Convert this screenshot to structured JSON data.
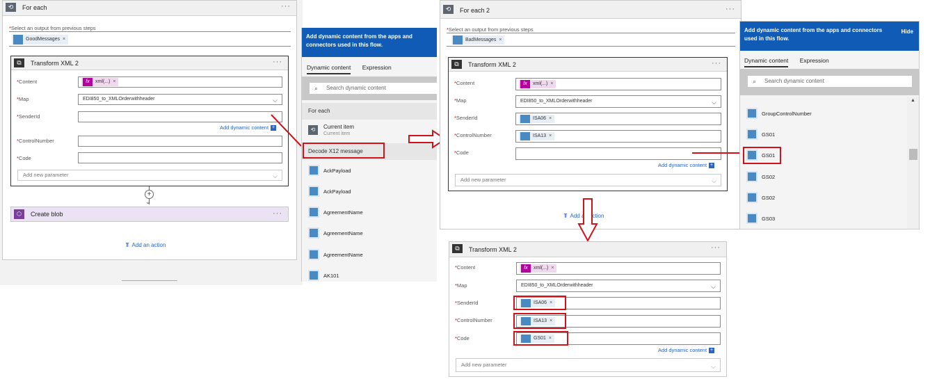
{
  "foreach1": {
    "title": "For each",
    "select_label": "Select an output from previous steps",
    "token": "GoodMessages",
    "transform": {
      "title": "Transform XML 2",
      "content_label": "Content",
      "content_token": "xml(...)",
      "map_label": "Map",
      "map_value": "EDI850_to_XMLOrderwithheader",
      "senderid_label": "SenderId",
      "add_dynamic": "Add dynamic content",
      "controlnumber_label": "ControlNumber",
      "code_label": "Code",
      "add_param": "Add new parameter"
    },
    "create_blob": "Create blob",
    "add_action": "Add an action"
  },
  "panel1": {
    "header": "Add dynamic content from the apps and connectors used in this flow.",
    "tab_dynamic": "Dynamic content",
    "tab_expression": "Expression",
    "search_placeholder": "Search dynamic content",
    "section_for_each": "For each",
    "current_item": "Current item",
    "current_item_sub": "Current item",
    "section_decode": "Decode X12 message",
    "items": [
      "AckPayload",
      "AckPayload",
      "AgreementName",
      "AgreementName",
      "AgreementName",
      "AK101"
    ]
  },
  "foreach2": {
    "title": "For each 2",
    "select_label": "Select an output from previous steps",
    "token": "BadMessages",
    "transform": {
      "title": "Transform XML 2",
      "content_label": "Content",
      "content_token": "xml(...)",
      "map_label": "Map",
      "map_value": "EDI850_to_XMLOrderwithheader",
      "senderid_label": "SenderId",
      "senderid_token": "ISA06",
      "controlnumber_label": "ControlNumber",
      "controlnumber_token": "ISA13",
      "code_label": "Code",
      "add_dynamic": "Add dynamic content",
      "add_param": "Add new parameter"
    },
    "add_action": "Add an action"
  },
  "panel2": {
    "header": "Add dynamic content from the apps and connectors used in this flow.",
    "hide": "Hide",
    "tab_dynamic": "Dynamic content",
    "tab_expression": "Expression",
    "search_placeholder": "Search dynamic content",
    "items": [
      "GroupControlNumber",
      "GS01",
      "GS01",
      "GS02",
      "GS02",
      "GS03"
    ]
  },
  "transform3": {
    "title": "Transform XML 2",
    "content_label": "Content",
    "content_token": "xml(...)",
    "map_label": "Map",
    "map_value": "EDI850_to_XMLOrderwithheader",
    "senderid_label": "SenderId",
    "senderid_token": "ISA06",
    "controlnumber_label": "ControlNumber",
    "controlnumber_token": "ISA13",
    "code_label": "Code",
    "code_token": "GS01",
    "add_dynamic": "Add dynamic content",
    "add_param": "Add new parameter"
  },
  "colors": {
    "accent_blue": "#0f5bb5",
    "highlight_red": "#d0121b",
    "expression_pink": "#b4009e"
  }
}
